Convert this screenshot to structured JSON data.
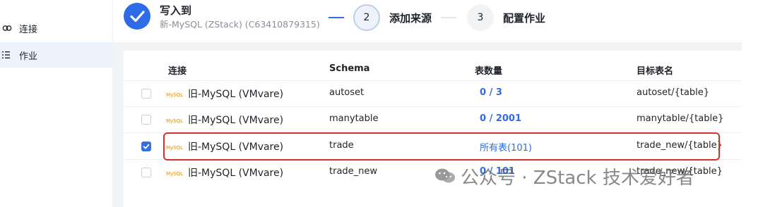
{
  "sidebar": {
    "items": [
      {
        "label": "连接",
        "icon": "link-icon",
        "active": false
      },
      {
        "label": "作业",
        "icon": "list-icon",
        "active": true
      }
    ]
  },
  "steps": {
    "step1": {
      "title": "写入到",
      "subtitle": "新-MySQL (ZStack) (C63410879315)",
      "status": "done"
    },
    "step2": {
      "number": "2",
      "title": "添加来源",
      "status": "active"
    },
    "step3": {
      "number": "3",
      "title": "配置作业",
      "status": "todo"
    }
  },
  "table": {
    "headers": [
      "连接",
      "Schema",
      "表数量",
      "目标表名"
    ],
    "rows": [
      {
        "checked": false,
        "connection": "旧-MySQL (VMvare)",
        "schema": "autoset",
        "count": "0 / 3",
        "target": "autoset/{table}"
      },
      {
        "checked": false,
        "connection": "旧-MySQL (VMvare)",
        "schema": "manytable",
        "count": "0 / 2001",
        "target": "manytable/{table}"
      },
      {
        "checked": true,
        "connection": "旧-MySQL (VMvare)",
        "schema": "trade",
        "count": "所有表(101)",
        "target": "trade_new/{table}"
      },
      {
        "checked": false,
        "connection": "旧-MySQL (VMvare)",
        "schema": "trade_new",
        "count": "0 / 101",
        "target": "trade_new/{table}"
      }
    ]
  },
  "logo_text": "MySQL",
  "watermark": "公众号 · ZStack 技术爱好者",
  "colors": {
    "primary": "#2e6be6",
    "highlight_border": "#d6302b",
    "active_sidebar_bg": "#edf3fc"
  }
}
